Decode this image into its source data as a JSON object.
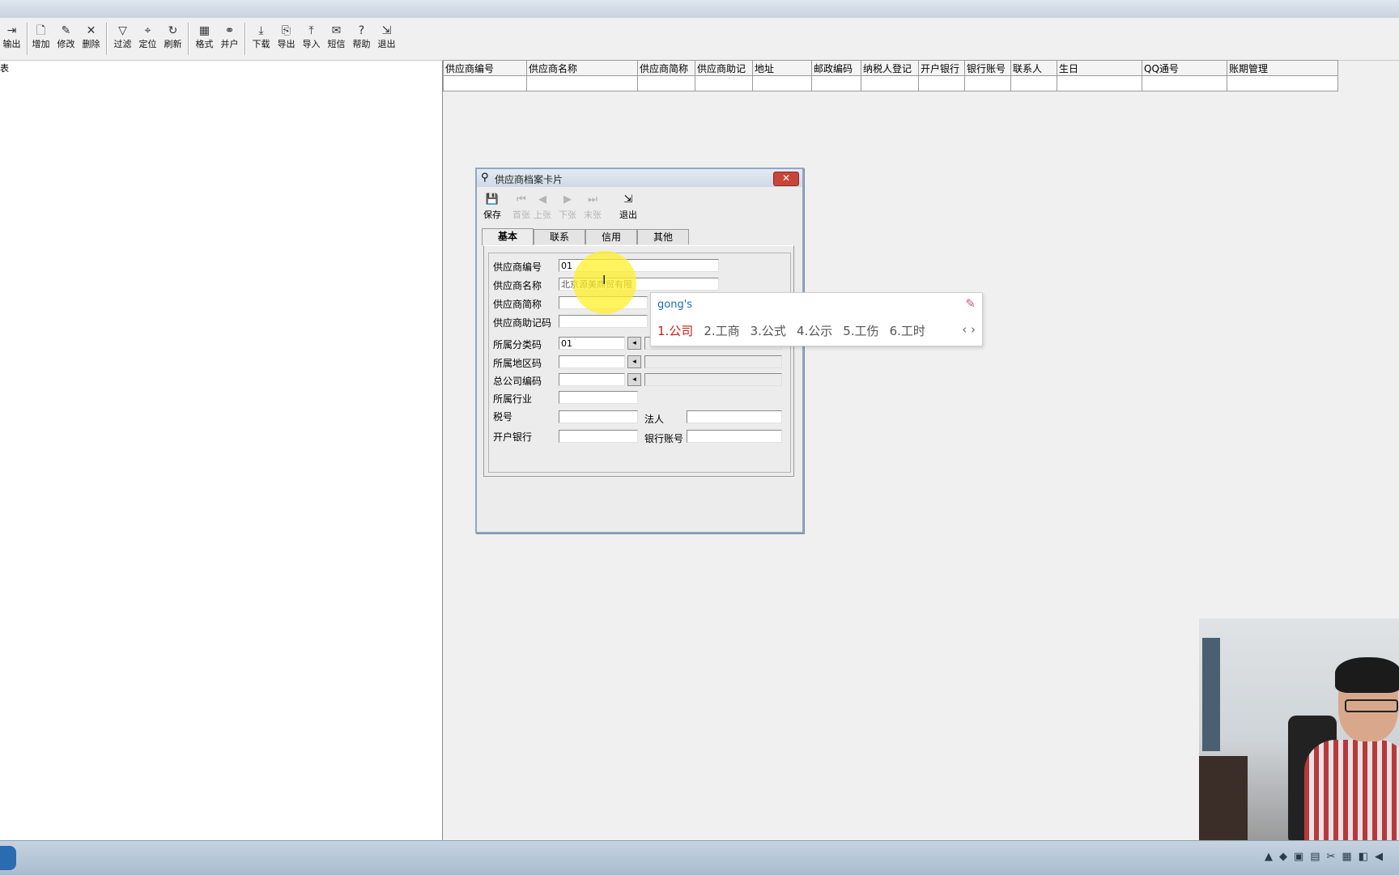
{
  "toolbar": {
    "buttons": [
      {
        "label": "输出",
        "icon": "export-icon",
        "glyph": "⇥"
      },
      {
        "label": "增加",
        "icon": "add-icon",
        "glyph": "🗋"
      },
      {
        "label": "修改",
        "icon": "edit-icon",
        "glyph": "✎"
      },
      {
        "label": "删除",
        "icon": "delete-icon",
        "glyph": "✕"
      },
      {
        "label": "过滤",
        "icon": "filter-icon",
        "glyph": "▽"
      },
      {
        "label": "定位",
        "icon": "locate-icon",
        "glyph": "⌖"
      },
      {
        "label": "刷新",
        "icon": "refresh-icon",
        "glyph": "↻"
      },
      {
        "label": "格式",
        "icon": "format-icon",
        "glyph": "▦"
      },
      {
        "label": "并户",
        "icon": "merge-icon",
        "glyph": "⚭"
      },
      {
        "label": "下载",
        "icon": "download-icon",
        "glyph": "⤓"
      },
      {
        "label": "导出",
        "icon": "export-file-icon",
        "glyph": "⎘"
      },
      {
        "label": "导入",
        "icon": "import-icon",
        "glyph": "⤒"
      },
      {
        "label": "短信",
        "icon": "sms-icon",
        "glyph": "✉"
      },
      {
        "label": "帮助",
        "icon": "help-icon",
        "glyph": "?"
      },
      {
        "label": "退出",
        "icon": "exit-icon",
        "glyph": "⇲"
      }
    ]
  },
  "left_panel": {
    "tree_text": "表"
  },
  "grid": {
    "columns": [
      "供应商编号",
      "供应商名称",
      "供应商简称",
      "供应商助记",
      "地址",
      "邮政编码",
      "纳税人登记",
      "开户银行",
      "银行账号",
      "联系人",
      "生日",
      "QQ通号",
      "账期管理"
    ]
  },
  "dialog": {
    "title": "供应商档案卡片",
    "toolbar": [
      {
        "label": "保存",
        "icon": "save-icon",
        "glyph": "💾",
        "enabled": true
      },
      {
        "label": "首张",
        "icon": "first-record-icon",
        "glyph": "⏮",
        "enabled": false
      },
      {
        "label": "上张",
        "icon": "prev-record-icon",
        "glyph": "◀",
        "enabled": false
      },
      {
        "label": "下张",
        "icon": "next-record-icon",
        "glyph": "▶",
        "enabled": false
      },
      {
        "label": "末张",
        "icon": "last-record-icon",
        "glyph": "⏭",
        "enabled": false
      },
      {
        "label": "退出",
        "icon": "exit-icon",
        "glyph": "⇲",
        "enabled": true
      }
    ],
    "tabs": [
      "基本",
      "联系",
      "信用",
      "其他"
    ],
    "active_tab": "基本",
    "fields": {
      "supplier_code": {
        "label": "供应商编号",
        "value": "01"
      },
      "supplier_name": {
        "label": "供应商名称",
        "value": "北京源美商贸有限"
      },
      "supplier_short": {
        "label": "供应商简称",
        "value": ""
      },
      "supplier_mnemonic": {
        "label": "供应商助记码",
        "value": ""
      },
      "category_code": {
        "label": "所属分类码",
        "value": "01"
      },
      "region_code": {
        "label": "所属地区码",
        "value": ""
      },
      "head_office_code": {
        "label": "总公司编码",
        "value": ""
      },
      "industry": {
        "label": "所属行业",
        "value": ""
      },
      "tax_no": {
        "label": "税号",
        "value": ""
      },
      "legal_person": {
        "label": "法人",
        "value": ""
      },
      "bank": {
        "label": "开户银行",
        "value": ""
      },
      "bank_account": {
        "label": "银行账号",
        "value": ""
      }
    }
  },
  "ime": {
    "composition": "gong's",
    "candidates": [
      "1.公司",
      "2.工商",
      "3.公式",
      "4.公示",
      "5.工伤",
      "6.工时"
    ],
    "nav": "‹ ›"
  }
}
